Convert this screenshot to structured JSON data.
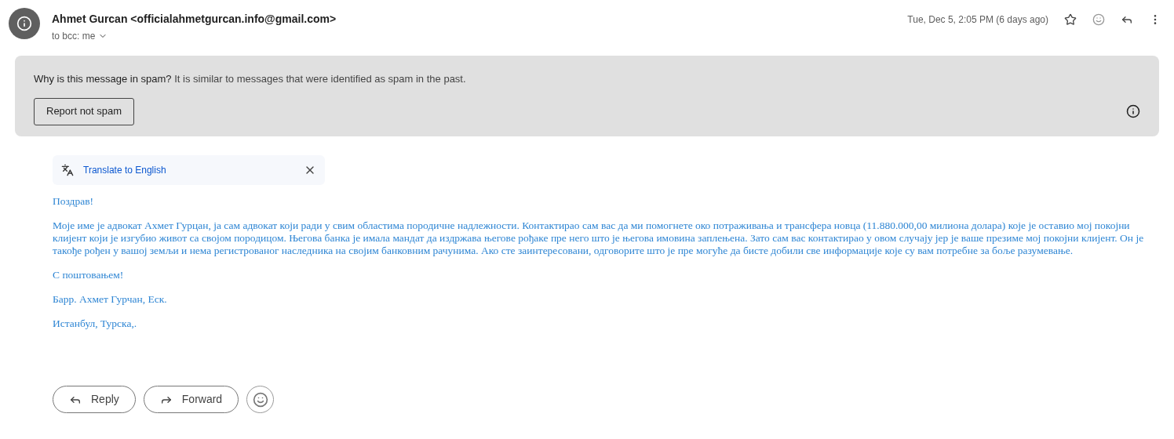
{
  "header": {
    "sender": "Ahmet Gurcan <officialahmetgurcan.info@gmail.com>",
    "recipients": "to bcc: me",
    "date": "Tue, Dec 5, 2:05 PM (6 days ago)",
    "starred": false
  },
  "spam_notice": {
    "text": "**Why is this message in spam?** It is similar to messages that were identified as spam in the past.",
    "button": "Report not spam"
  },
  "translate_bar": {
    "link": "Translate to English"
  },
  "body": [
    "Поздрав!",
    "Моје име је адвокат Ахмет Гурцан, ја сам адвокат који ради у свим областима породичне надлежности. Контактирао сам вас да ми помогнете око потраживања и трансфера новца (11.880.000,00 милиона долара) које је оставио мој покојни клијент који је изгубио живот са својом породицом. Његова банка је имала мандат да издржава његове рођаке пре него што је његова имовина заплењена. Зато сам вас контактирао у овом случају јер је ваше презиме мој покојни клијент. Он је такође рођен у вашој земљи и нема регистрованог наследника на својим банковним рачунима. Ако сте заинтересовани, одговорите што је пре могуће да бисте добили све информације које су вам потребне за боље разумевање.",
    "С поштовањем!",
    "Барр. Ахмет Гурчан, Еск.",
    "Истанбул, Турска,."
  ],
  "actions": [
    {
      "kind": "reply",
      "label": "Reply"
    },
    {
      "kind": "forward",
      "label": "Forward"
    },
    {
      "kind": "emoji"
    }
  ]
}
